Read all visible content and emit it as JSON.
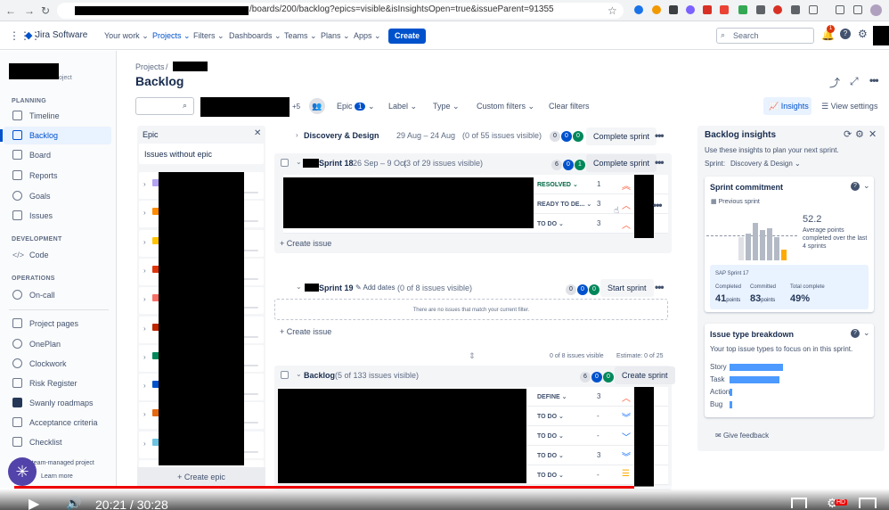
{
  "browser": {
    "url_tail": "/boards/200/backlog?epics=visible&isInsightsOpen=true&issueParent=91355"
  },
  "topnav": {
    "logo": "Jira Software",
    "items": [
      "Your work",
      "Projects",
      "Filters",
      "Dashboards",
      "Teams",
      "Plans",
      "Apps"
    ],
    "create": "Create",
    "search_placeholder": "Search",
    "notif_count": "1"
  },
  "sidebar": {
    "project_suffix": "oject",
    "planning_head": "PLANNING",
    "planning": [
      "Timeline",
      "Backlog",
      "Board",
      "Reports",
      "Goals",
      "Issues"
    ],
    "development_head": "DEVELOPMENT",
    "development": [
      "Code"
    ],
    "operations_head": "OPERATIONS",
    "operations": [
      "On-call"
    ],
    "other": [
      "Project pages",
      "OnePlan",
      "Clockwork",
      "Risk Register",
      "Swanly roadmaps",
      "Acceptance criteria",
      "Checklist"
    ],
    "footer_text": "a team-managed project",
    "learn_more": "Learn more"
  },
  "header": {
    "crumb_projects": "Projects",
    "crumb_sep": "/",
    "title": "Backlog"
  },
  "filters": {
    "avatars_more": "+5",
    "epic": "Epic",
    "epic_count": "1",
    "label": "Label",
    "type": "Type",
    "custom": "Custom filters",
    "clear": "Clear filters",
    "insights": "Insights",
    "view_settings": "View settings"
  },
  "epic_panel": {
    "title": "Epic",
    "without": "Issues without epic",
    "create": "+ Create epic",
    "colors": [
      "#b3a3f0",
      "#ff8b00",
      "#ffc400",
      "#de350b",
      "#f87168",
      "#bf2600",
      "#00875a",
      "#0052cc",
      "#e56910",
      "#6cc3e0",
      "#c9372c"
    ]
  },
  "sprints": {
    "discovery": {
      "name": "Discovery & Design",
      "dates": "29 Aug – 24 Aug",
      "visible": "(0 of 55 issues visible)",
      "c1": "0",
      "c2": "0",
      "c3": "0",
      "btn": "Complete sprint"
    },
    "s18": {
      "name": "Sprint 18",
      "dates": "26 Sep – 9 Oct",
      "visible": "(3 of 29 issues visible)",
      "c1": "6",
      "c2": "0",
      "c3": "1",
      "btn": "Complete sprint",
      "issues": [
        {
          "status": "RESOLVED",
          "pts": "1"
        },
        {
          "status": "READY TO DE...",
          "pts": "3"
        },
        {
          "status": "TO DO",
          "pts": "3"
        }
      ]
    },
    "create_issue": "+ Create issue",
    "s19": {
      "name": "Sprint 19",
      "add_dates": "Add dates",
      "visible": "(0 of 8 issues visible)",
      "c1": "0",
      "c2": "0",
      "c3": "0",
      "btn": "Start sprint",
      "empty": "There are no issues that match your current filter."
    },
    "summary": {
      "visible": "0 of 8 issues visible",
      "estimate": "Estimate: 0 of 25"
    },
    "backlog": {
      "name": "Backlog",
      "visible": "(5 of 133 issues visible)",
      "c1": "6",
      "c2": "0",
      "c3": "0",
      "btn": "Create sprint",
      "issues": [
        {
          "status": "DEFINE",
          "pts": "3"
        },
        {
          "status": "TO DO",
          "pts": "-"
        },
        {
          "status": "TO DO",
          "pts": "-"
        },
        {
          "status": "TO DO",
          "pts": "3"
        },
        {
          "status": "TO DO",
          "pts": "-"
        }
      ]
    }
  },
  "insights": {
    "title": "Backlog insights",
    "subtitle": "Use these insights to plan your next sprint.",
    "sprint_label": "Sprint:",
    "sprint_value": "Discovery & Design",
    "commitment": {
      "title": "Sprint commitment",
      "previous": "Previous sprint",
      "avg": "52.2",
      "avg_text": "Average points completed over the last 4 sprints",
      "sprint_name": "SAP Sprint 17",
      "completed_label": "Completed",
      "completed": "41",
      "committed_label": "Committed",
      "committed": "83",
      "total_label": "Total complete",
      "total": "49%",
      "points": "points"
    },
    "breakdown": {
      "title": "Issue type breakdown",
      "subtitle": "Your top issue types to focus on in this sprint.",
      "types": [
        {
          "name": "Story",
          "frac": 0.54
        },
        {
          "name": "Task",
          "frac": 0.5
        },
        {
          "name": "Action",
          "frac": 0.03
        },
        {
          "name": "Bug",
          "frac": 0.02
        }
      ]
    },
    "feedback": "Give feedback"
  },
  "video": {
    "time": "20:21 / 30:28",
    "progress": 0.7
  }
}
